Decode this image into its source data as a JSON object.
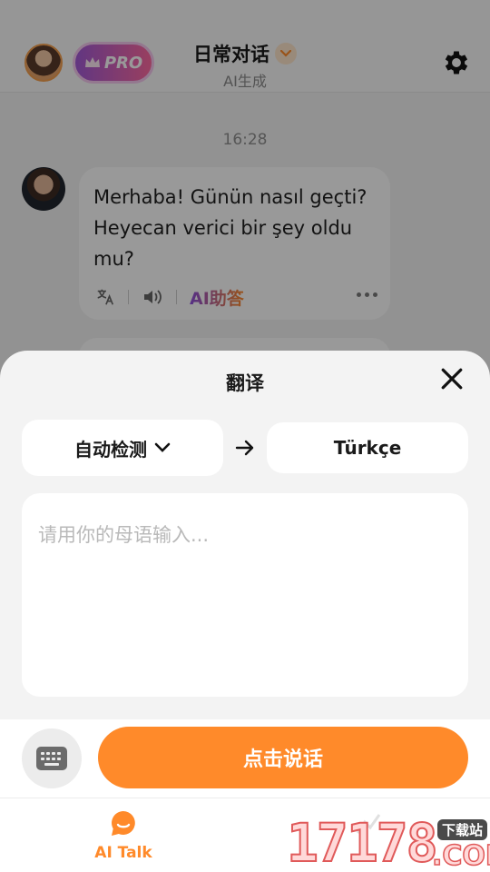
{
  "header": {
    "pro_label": "PRO",
    "title": "日常对话",
    "subtitle": "AI生成"
  },
  "chat": {
    "timestamp": "16:28",
    "message": "Merhaba! Günün nasıl geçti? Heyecan verici bir şey oldu mu?",
    "ai_assist_label": "AI助答"
  },
  "translate_sheet": {
    "title": "翻译",
    "source_lang": "自动检测",
    "target_lang": "Türkçe",
    "input_placeholder": "请用你的母语输入..."
  },
  "input_bar": {
    "talk_label": "点击说话"
  },
  "tabbar": {
    "ai_talk_label": "AI Talk"
  },
  "watermark": {
    "number": "17178",
    "domain": ".COM",
    "tag": "下载站"
  },
  "colors": {
    "accent": "#ff8a2a",
    "pro_gradient_start": "#a35bd8",
    "pro_gradient_end": "#ff6aa0"
  }
}
